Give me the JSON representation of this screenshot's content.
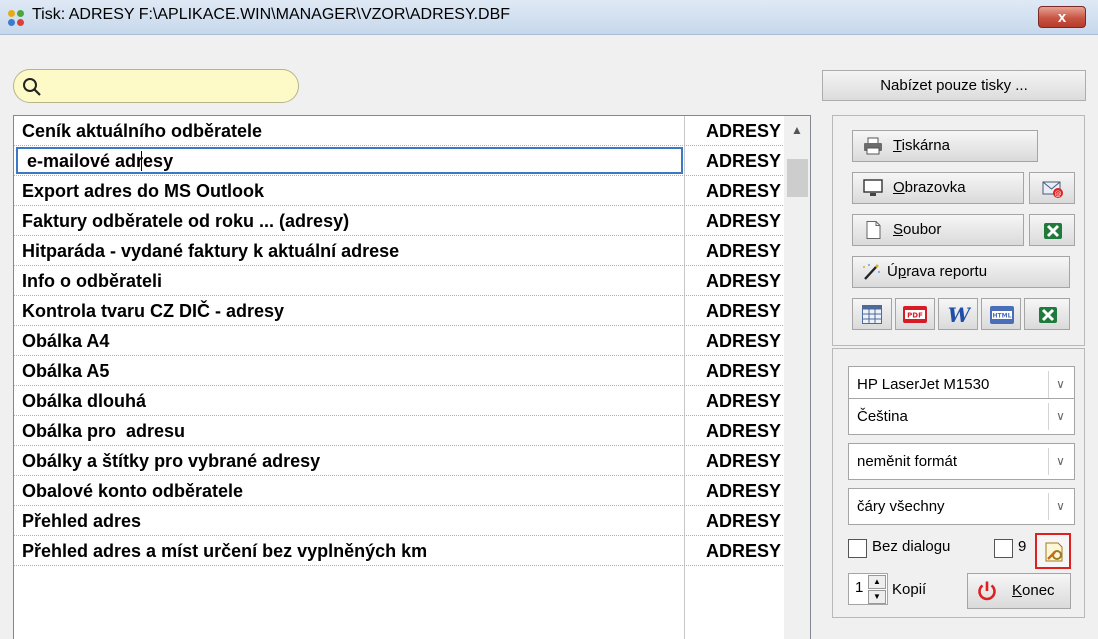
{
  "window": {
    "title": "Tisk: ADRESY F:\\APLIKACE.WIN\\MANAGER\\VZOR\\ADRESY.DBF",
    "close_label": "x"
  },
  "search": {
    "value": "",
    "icon": "search-icon"
  },
  "offer_button": "Nabízet pouze tisky ...",
  "reports": [
    {
      "name": "Ceník aktuálního odběratele",
      "file": "ADRESY"
    },
    {
      "name": "e-mailové adresy",
      "file": "ADRESY"
    },
    {
      "name": "Export adres do MS Outlook",
      "file": "ADRESY"
    },
    {
      "name": "Faktury odběratele od roku ... (adresy)",
      "file": "ADRESY"
    },
    {
      "name": "Hitparáda - vydané faktury k aktuální adrese",
      "file": "ADRESY"
    },
    {
      "name": "Info o odběrateli",
      "file": "ADRESY"
    },
    {
      "name": "Kontrola tvaru CZ DIČ - adresy",
      "file": "ADRESY"
    },
    {
      "name": "Obálka A4",
      "file": "ADRESY"
    },
    {
      "name": "Obálka A5",
      "file": "ADRESY"
    },
    {
      "name": "Obálka dlouhá",
      "file": "ADRESY"
    },
    {
      "name": "Obálka pro  adresu",
      "file": "ADRESY"
    },
    {
      "name": "Obálky a štítky pro vybrané adresy",
      "file": "ADRESY"
    },
    {
      "name": "Obalové konto odběratele",
      "file": "ADRESY"
    },
    {
      "name": "Přehled adres",
      "file": "ADRESY"
    },
    {
      "name": "Přehled adres a míst určení bez vyplněných km",
      "file": "ADRESY"
    }
  ],
  "actions": {
    "printer": {
      "key": "T",
      "rest": "iskárna"
    },
    "screen": {
      "key": "O",
      "rest": "brazovka"
    },
    "file": {
      "key": "S",
      "rest": "oubor"
    },
    "edit_report": {
      "pre": "Ú",
      "key": "p",
      "rest": "rava reportu"
    }
  },
  "selects": {
    "printer": "HP LaserJet M1530",
    "language": "Čeština",
    "format": "neměnit formát",
    "lines": "čáry všechny"
  },
  "options": {
    "no_dialog_label": "Bez dialogu",
    "no_dialog_checked": false,
    "second_value": "9",
    "copies": "1",
    "copies_label": "Kopií",
    "end": {
      "key": "K",
      "rest": "onec"
    }
  },
  "colors": {
    "accent": "#3b78c6",
    "search_bg": "#fdfac7",
    "power_icon": "#e02020"
  }
}
